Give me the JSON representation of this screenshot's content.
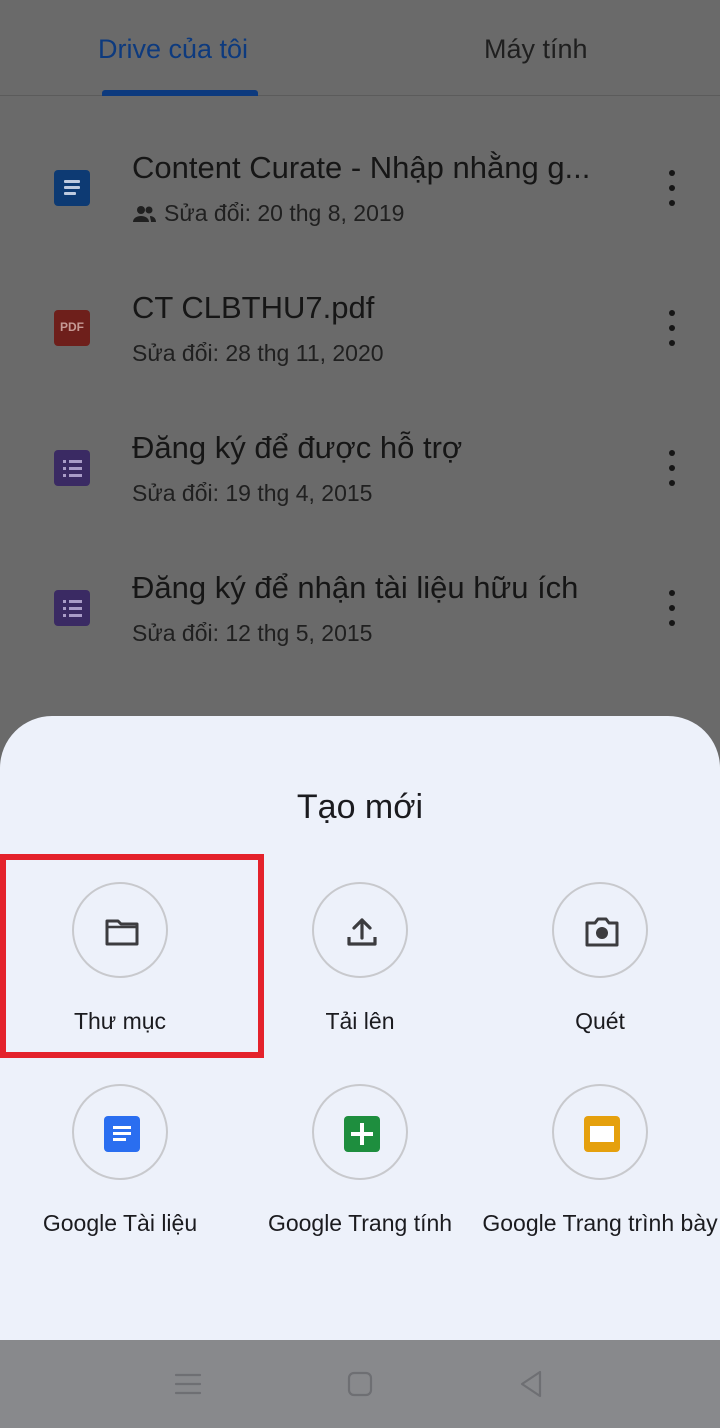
{
  "tabs": {
    "active": "Drive của tôi",
    "inactive": "Máy tính"
  },
  "files": [
    {
      "type": "doc-icon",
      "title": "Content Curate - Nhập nhằng g...",
      "meta": "Sửa đổi: 20 thg 8, 2019",
      "shared": true
    },
    {
      "type": "pdf-icon",
      "title": "CT CLBTHU7.pdf",
      "meta": "Sửa đổi: 28 thg 11, 2020",
      "shared": false
    },
    {
      "type": "form-icon",
      "title": "Đăng ký để được hỗ trợ",
      "meta": "Sửa đổi: 19 thg 4, 2015",
      "shared": false
    },
    {
      "type": "form-icon",
      "title": "Đăng ký để nhận tài liệu hữu ích",
      "meta": "Sửa đổi: 12 thg 5, 2015",
      "shared": false
    }
  ],
  "pdf_badge": "PDF",
  "sheet": {
    "title": "Tạo mới",
    "options": [
      {
        "label": "Thư mục",
        "icon": "folder-icon"
      },
      {
        "label": "Tải lên",
        "icon": "upload-icon"
      },
      {
        "label": "Quét",
        "icon": "camera-icon"
      },
      {
        "label": "Google Tài liệu",
        "icon": "google-docs-icon"
      },
      {
        "label": "Google Trang tính",
        "icon": "google-sheets-icon"
      },
      {
        "label": "Google Trang trình bày",
        "icon": "google-slides-icon"
      }
    ]
  },
  "colors": {
    "highlight": "#e4222b",
    "docs_blue": "#2a6ef0",
    "sheets_green": "#1e8e3e",
    "slides_yellow": "#e5a00d",
    "active_tab": "#0d3a7e"
  },
  "navbar": [
    "menu-icon",
    "home-icon",
    "back-icon"
  ]
}
